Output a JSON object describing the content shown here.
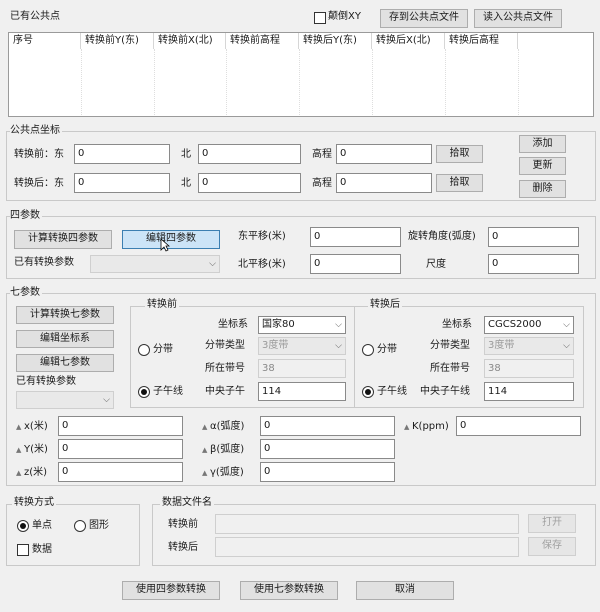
{
  "common_points": {
    "title": "已有公共点",
    "flip_xy_label": "颠倒XY",
    "save_button": "存到公共点文件",
    "load_button": "读入公共点文件",
    "columns": [
      "序号",
      "转换前Y(东)",
      "转换前X(北)",
      "转换前高程",
      "转换后Y(东)",
      "转换后X(北)",
      "转换后高程"
    ]
  },
  "coord": {
    "title": "公共点坐标",
    "before_east_label": "转换前：东",
    "after_east_label": "转换后：东",
    "north_label": "北",
    "height_label": "高程",
    "before_east": "0",
    "before_north": "0",
    "before_height": "0",
    "after_east": "0",
    "after_north": "0",
    "after_height": "0",
    "pick_label": "拾取",
    "add_button": "添加",
    "update_button": "更新",
    "delete_button": "删除"
  },
  "four_param": {
    "title": "四参数",
    "calc_button": "计算转换四参数",
    "edit_button": "编辑四参数",
    "existing_label": "已有转换参数",
    "existing_value": "",
    "east_shift_label": "东平移(米)",
    "east_shift": "0",
    "north_shift_label": "北平移(米)",
    "north_shift": "0",
    "rotation_label": "旋转角度(弧度)",
    "rotation": "0",
    "scale_label": "尺度",
    "scale": "0"
  },
  "seven_param": {
    "title": "七参数",
    "calc_button": "计算转换七参数",
    "edit_coord_button": "编辑坐标系",
    "edit_seven_button": "编辑七参数",
    "existing_label": "已有转换参数",
    "existing_value": "",
    "before": {
      "title": "转换前",
      "coord_sys_label": "坐标系",
      "coord_sys": "国家80",
      "zone_label": "分带",
      "meridian_label": "子午线",
      "zone_type_label": "分带类型",
      "zone_type": "3度带",
      "zone_no_label": "所在带号",
      "zone_no": "38",
      "central_meridian_label": "中央子午",
      "central_meridian": "114"
    },
    "after": {
      "title": "转换后",
      "coord_sys_label": "坐标系",
      "coord_sys": "CGCS2000",
      "zone_label": "分带",
      "meridian_label": "子午线",
      "zone_type_label": "分带类型",
      "zone_type": "3度带",
      "zone_no_label": "所在带号",
      "zone_no": "38",
      "central_meridian_label": "中央子午线",
      "central_meridian": "114"
    },
    "x_label": "x(米)",
    "x": "0",
    "y_label": "Y(米)",
    "y": "0",
    "z_label": "z(米)",
    "z": "0",
    "alpha_label": "α(弧度)",
    "alpha": "0",
    "beta_label": "β(弧度)",
    "beta": "0",
    "gamma_label": "γ(弧度)",
    "gamma": "0",
    "k_label": "K(ppm)",
    "k": "0"
  },
  "mode": {
    "title": "转换方式",
    "single_label": "单点",
    "graphic_label": "图形",
    "data_label": "数据"
  },
  "datafile": {
    "title": "数据文件名",
    "before_label": "转换前",
    "after_label": "转换后",
    "before_value": "",
    "after_value": "",
    "open_button": "打开",
    "save_button": "保存"
  },
  "footer": {
    "four_button": "使用四参数转换",
    "seven_button": "使用七参数转换",
    "cancel_button": "取消"
  }
}
